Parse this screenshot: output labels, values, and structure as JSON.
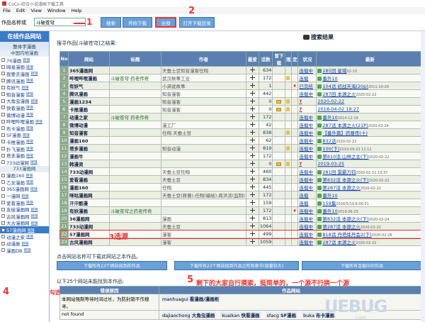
{
  "window": {
    "title": "CoCo-综合小说漫画下载工具"
  },
  "menu": [
    "File",
    "Edit",
    "View",
    "Window",
    "Help"
  ],
  "toolbar": {
    "label": "作品名称或",
    "input_value": "斗破苍穹",
    "btn_search": "搜索",
    "btn_start": "开始下载",
    "btn_all": "全部",
    "btn_open": "打开下载目录"
  },
  "annotations": {
    "a1": "1",
    "a2": "2",
    "a3": "3选源",
    "a4": "4",
    "a4_text": "勾选",
    "a5_num": "5",
    "a5_text": "剩下的大家自行摸索，挺简单的，一个源不行换一个源"
  },
  "sidebar": {
    "title": "在线作品网站",
    "subtitle": "整体字漫画",
    "group1": "中国内地漫画",
    "items1": [
      "76漫画",
      "网易漫画",
      "我要去漫画",
      "腾讯漫画",
      "有妖气",
      "知音漫客",
      "大角虫漫画",
      "快看漫画",
      "微博动漫",
      "哔哩哔哩漫画",
      "布卡漫画",
      "SF漫画",
      "卡推漫画",
      "扑飞漫画",
      "塔多漫画",
      "733动漫网"
    ],
    "group2": "733漫画网",
    "items2": [
      "漫画160",
      "乙女漫画",
      "365漫画网",
      "一漫网",
      "爱看漫画",
      "友绘漫画网",
      "古风漫画网",
      "大古漫画网",
      "57漫画网",
      "动漫之家",
      "动漫屋",
      "漫画DB"
    ],
    "link": "链接"
  },
  "main": {
    "search_header": "搜寻作品[斗破苍穹]之结果:",
    "results_title": "搜索结果",
    "columns": [
      "No",
      "网站",
      "标题",
      "作者",
      "最爱",
      "话数",
      "曾下载",
      "限",
      "定",
      "状况",
      "最新"
    ],
    "rows": [
      {
        "no": "1",
        "site": "365漫画网",
        "title": "",
        "author": "天蚕土豆知音漫客任翔",
        "count": "634",
        "status": "连载中",
        "latest": "285回 星域",
        "date": "02-10"
      },
      {
        "no": "2",
        "site": "哔哩哔哩漫画",
        "title": "斗破苍穹·药老传奇",
        "author": "武汉故事工业",
        "count": "172",
        "status": "连载",
        "latest": "番外10",
        "date": ""
      },
      {
        "no": "3",
        "site": "有妖气",
        "title": "",
        "author": "小满说故事",
        "count": "1",
        "status": "已完结",
        "latest": "104话 初战天海(20p)",
        "date": "2011-10-28"
      },
      {
        "no": "4",
        "site": "腾讯漫画",
        "title": "",
        "author": "知音漫客",
        "count": "442",
        "status": "连载中",
        "latest": "287回 本源之火",
        "date": "2020-02-22"
      },
      {
        "no": "5",
        "site": "漫画1234",
        "title": "",
        "author": "知音漫客",
        "count": "0",
        "status": "",
        "latest": "2020-02-22",
        "date": ""
      },
      {
        "no": "6",
        "site": "卡推漫画",
        "title": "",
        "author": "知音漫客",
        "count": "0",
        "status": "",
        "latest": "2018-04-02 19:27",
        "date": ""
      },
      {
        "no": "7",
        "site": "动漫之家",
        "title": "斗破苍穹 药老传奇",
        "author": "",
        "count": "172",
        "status": "连载中",
        "latest": "番外10",
        "date": "2014-12-18"
      },
      {
        "no": "8",
        "site": "微博动漫",
        "title": "",
        "author": "漫工厂",
        "count": "42",
        "status": "连载中",
        "latest": "287话 本源之火(21P)",
        "date": "2020-02-24"
      },
      {
        "no": "9",
        "site": "知音漫客",
        "title": "",
        "author": "任翔 天蚕土豆",
        "count": "838",
        "status": "连载中",
        "latest": "【番外篇】药尊传(十)",
        "date": ""
      },
      {
        "no": "10",
        "site": "漫画160",
        "title": "",
        "author": "",
        "count": "62",
        "status": "连载中",
        "latest": "832话",
        "date": "2020-02-22"
      },
      {
        "no": "11",
        "site": "塔多漫画",
        "title": "",
        "author": "知音动漫",
        "count": "819",
        "status": "连载中",
        "latest": "100(下)",
        "date": "2019-09-23 13:12"
      },
      {
        "no": "12",
        "site": "漫画牛",
        "title": "",
        "author": "",
        "count": "172",
        "status": "连载中",
        "latest": "第810话 山林之主(下)",
        "date": "2020-02-22"
      },
      {
        "no": "13",
        "site": "韩漫资",
        "title": "",
        "author": "",
        "count": "0",
        "status": "",
        "latest": "2019-03-25",
        "date": ""
      },
      {
        "no": "14",
        "site": "733动漫网",
        "title": "",
        "author": "天蚕土豆任翔",
        "count": "460",
        "status": "连载中",
        "latest": "281回 雷霸万钧",
        "date": "2020-01-11 13:37"
      },
      {
        "no": "15",
        "site": "爱看漫画",
        "title": "",
        "author": "天蚕土豆",
        "count": "834",
        "status": "连载中",
        "latest": "第832话 本源之火(下)",
        "date": "2020-02-22"
      },
      {
        "no": "16",
        "site": "漫画160",
        "title": "",
        "author": "任翔",
        "count": "445",
        "status": "连载中",
        "latest": "第287话 本源之火",
        "date": "2020-02-22"
      },
      {
        "no": "17",
        "site": "咪咕漫画网",
        "title": "",
        "author": "天蚕土豆(原著),任翔(编绘),周洪滨(监制)",
        "count": "172",
        "status": "连载",
        "latest": "番外10",
        "date": ""
      },
      {
        "no": "18",
        "site": "汗汗酷漫",
        "title": "",
        "author": "",
        "count": "159",
        "status": "连载",
        "latest": "159集",
        "date": "2016/5/19 6:06:51"
      },
      {
        "no": "19",
        "site": "有妖漫画",
        "title": "斗破苍穹之药老传奇",
        "author": "",
        "count": "172",
        "status": "连载中",
        "latest": "番外10",
        "date": "2019-06-25"
      },
      {
        "no": "20",
        "site": "36漫画网",
        "title": "",
        "author": "漫画",
        "count": "813",
        "status": "连载中",
        "latest": "第832话 本源之火(下)",
        "date": "2020-02-24"
      },
      {
        "no": "21",
        "site": "733动漫网",
        "title": "",
        "author": "天蚕土豆",
        "count": "1064",
        "status": "连载中",
        "latest": "第287话 本源之火",
        "date": "2020-02-22"
      },
      {
        "no": "22",
        "site": "57漫画网",
        "title": "",
        "author": "漫客",
        "count": "499",
        "status": "连载中",
        "latest": "818话 丹塔炼丹会2(下)",
        "date": "2020-02-26"
      },
      {
        "no": "23",
        "site": "古风漫画网",
        "title": "",
        "author": "漫客",
        "count": "1059",
        "status": "连载中",
        "latest": "287话 本源之火",
        "date": "2020-02-22"
      }
    ],
    "footnote": "点击网站名称可下载此网站之本作品。",
    "dl_btn1": "下载所有23个网站找到的作品",
    "dl_btn2": "下载所有23个网站找到作品之所有章节(容量较大)",
    "dl_btn3": "下载所有连载中的作品",
    "notfound_header": "以下25个网站未能找到本作品:",
    "nf_col1": "错误原因",
    "nf_col2": "作品网站",
    "nf_reason1": "本网站强制等待时间过长，为防封锁不作搜寻。",
    "nf_reason2": "not found",
    "nf_sites1": [
      {
        "site": "manhuagui",
        "name": "看漫画/漫画柜"
      }
    ],
    "nf_sites2": [
      {
        "site": "dajiaochong",
        "name": "大角虫漫画"
      },
      {
        "site": "kuaikan",
        "name": "快看漫画"
      },
      {
        "site": "sfacg",
        "name": "SF漫画"
      },
      {
        "site": "buka",
        "name": "布卡漫画"
      }
    ]
  },
  "watermark": "UEBUG",
  "watermark_sub": ".com"
}
